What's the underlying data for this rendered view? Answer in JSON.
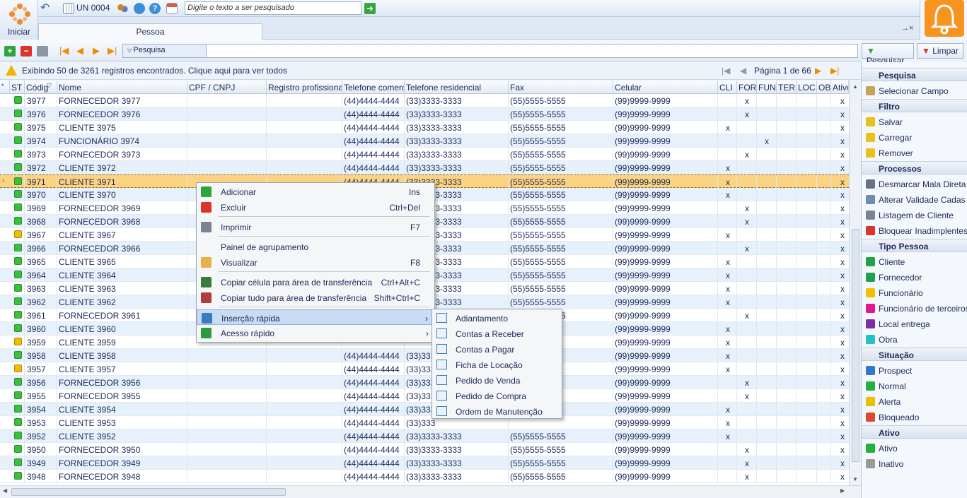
{
  "toolbar": {
    "start_label": "Iniciar",
    "unit_label": "UN 0004",
    "search_placeholder": "Digite o texto a ser pesquisado"
  },
  "tab": {
    "label": "Pessoa",
    "controls": "→×"
  },
  "toolbar2": {
    "search_label": "Pesquisa",
    "search_button": "Pesquisar",
    "clear_button": "Limpar"
  },
  "status": {
    "message": "Exibindo 50 de 3261 registros encontrados. Clique aqui para ver todos",
    "page": "Página 1 de 66"
  },
  "columns": [
    {
      "key": "st",
      "label": "ST"
    },
    {
      "key": "cod",
      "label": "Códig"
    },
    {
      "key": "nome",
      "label": "Nome"
    },
    {
      "key": "cpf",
      "label": "CPF / CNPJ"
    },
    {
      "key": "reg",
      "label": "Registro profissional"
    },
    {
      "key": "tc",
      "label": "Telefone comercial"
    },
    {
      "key": "tr",
      "label": "Telefone residencial"
    },
    {
      "key": "fax",
      "label": "Fax"
    },
    {
      "key": "cel",
      "label": "Celular"
    },
    {
      "key": "cli",
      "label": "CLI"
    },
    {
      "key": "for",
      "label": "FOR"
    },
    {
      "key": "fun",
      "label": "FUN"
    },
    {
      "key": "ter",
      "label": "TER"
    },
    {
      "key": "loc",
      "label": "LOC"
    },
    {
      "key": "obr",
      "label": "OBI"
    },
    {
      "key": "ativo",
      "label": "Ativo"
    }
  ],
  "rows": [
    {
      "st": "green",
      "cod": "3977",
      "nome": "FORNECEDOR  3977",
      "tc": "(44)4444-4444",
      "tr": "(33)3333-3333",
      "fax": "(55)5555-5555",
      "cel": "(99)9999-9999",
      "flag": "for"
    },
    {
      "st": "green",
      "cod": "3976",
      "nome": "FORNECEDOR  3976",
      "tc": "(44)4444-4444",
      "tr": "(33)3333-3333",
      "fax": "(55)5555-5555",
      "cel": "(99)9999-9999",
      "flag": "for"
    },
    {
      "st": "green",
      "cod": "3975",
      "nome": "CLIENTE  3975",
      "tc": "(44)4444-4444",
      "tr": "(33)3333-3333",
      "fax": "(55)5555-5555",
      "cel": "(99)9999-9999",
      "flag": "cli"
    },
    {
      "st": "green",
      "cod": "3974",
      "nome": "FUNCIONÁRIO  3974",
      "tc": "(44)4444-4444",
      "tr": "(33)3333-3333",
      "fax": "(55)5555-5555",
      "cel": "(99)9999-9999",
      "flag": "fun"
    },
    {
      "st": "green",
      "cod": "3973",
      "nome": "FORNECEDOR  3973",
      "tc": "(44)4444-4444",
      "tr": "(33)3333-3333",
      "fax": "(55)5555-5555",
      "cel": "(99)9999-9999",
      "flag": "for"
    },
    {
      "st": "green",
      "cod": "3972",
      "nome": "CLIENTE  3972",
      "tc": "(44)4444-4444",
      "tr": "(33)3333-3333",
      "fax": "(55)5555-5555",
      "cel": "(99)9999-9999",
      "flag": "cli"
    },
    {
      "st": "green",
      "cod": "3971",
      "nome": "CLIENTE  3971",
      "tc": "(44)4444-4444",
      "tr": "(33)3333-3333",
      "fax": "(55)5555-5555",
      "cel": "(99)9999-9999",
      "flag": "cli",
      "selected": true
    },
    {
      "st": "green",
      "cod": "3970",
      "nome": "CLIENTE  3970",
      "tc": "",
      "tr": "(33)3333-3333",
      "fax": "(55)5555-5555",
      "cel": "(99)9999-9999",
      "flag": "cli"
    },
    {
      "st": "green",
      "cod": "3969",
      "nome": "FORNECEDOR  3969",
      "tc": "",
      "tr": "(33)3333-3333",
      "fax": "(55)5555-5555",
      "cel": "(99)9999-9999",
      "flag": "for"
    },
    {
      "st": "green",
      "cod": "3968",
      "nome": "FORNECEDOR  3968",
      "tc": "",
      "tr": "(33)3333-3333",
      "fax": "(55)5555-5555",
      "cel": "(99)9999-9999",
      "flag": "for"
    },
    {
      "st": "yellow",
      "cod": "3967",
      "nome": "CLIENTE  3967",
      "tc": "",
      "tr": "(33)3333-3333",
      "fax": "(55)5555-5555",
      "cel": "(99)9999-9999",
      "flag": "cli"
    },
    {
      "st": "green",
      "cod": "3966",
      "nome": "FORNECEDOR  3966",
      "tc": "",
      "tr": "(33)3333-3333",
      "fax": "(55)5555-5555",
      "cel": "(99)9999-9999",
      "flag": "for"
    },
    {
      "st": "green",
      "cod": "3965",
      "nome": "CLIENTE  3965",
      "tc": "",
      "tr": "(33)3333-3333",
      "fax": "(55)5555-5555",
      "cel": "(99)9999-9999",
      "flag": "cli"
    },
    {
      "st": "green",
      "cod": "3964",
      "nome": "CLIENTE  3964",
      "tc": "",
      "tr": "(33)3333-3333",
      "fax": "(55)5555-5555",
      "cel": "(99)9999-9999",
      "flag": "cli"
    },
    {
      "st": "green",
      "cod": "3963",
      "nome": "CLIENTE  3963",
      "tc": "",
      "tr": "(33)3333-3333",
      "fax": "(55)5555-5555",
      "cel": "(99)9999-9999",
      "flag": "cli"
    },
    {
      "st": "green",
      "cod": "3962",
      "nome": "CLIENTE  3962",
      "tc": "",
      "tr": "(33)3333-3333",
      "fax": "(55)5555-5555",
      "cel": "(99)9999-9999",
      "flag": "cli"
    },
    {
      "st": "green",
      "cod": "3961",
      "nome": "FORNECEDOR  3961",
      "tc": "",
      "tr": "",
      "fax": "(55)5555-5555",
      "cel": "(99)9999-9999",
      "flag": "for"
    },
    {
      "st": "green",
      "cod": "3960",
      "nome": "CLIENTE  3960",
      "tc": "",
      "tr": "",
      "fax": "",
      "cel": "(99)9999-9999",
      "flag": "cli"
    },
    {
      "st": "yellow",
      "cod": "3959",
      "nome": "CLIENTE  3959",
      "tc": "",
      "tr": "",
      "fax": "",
      "cel": "(99)9999-9999",
      "flag": "cli"
    },
    {
      "st": "green",
      "cod": "3958",
      "nome": "CLIENTE  3958",
      "tc": "(44)4444-4444",
      "tr": "(33)333",
      "fax": "",
      "cel": "(99)9999-9999",
      "flag": "cli"
    },
    {
      "st": "yellow",
      "cod": "3957",
      "nome": "CLIENTE  3957",
      "tc": "(44)4444-4444",
      "tr": "(33)333",
      "fax": "",
      "cel": "(99)9999-9999",
      "flag": "cli"
    },
    {
      "st": "green",
      "cod": "3956",
      "nome": "FORNECEDOR  3956",
      "tc": "(44)4444-4444",
      "tr": "(33)333",
      "fax": "",
      "cel": "(99)9999-9999",
      "flag": "for"
    },
    {
      "st": "green",
      "cod": "3955",
      "nome": "FORNECEDOR  3955",
      "tc": "(44)4444-4444",
      "tr": "(33)333",
      "fax": "",
      "cel": "(99)9999-9999",
      "flag": "for"
    },
    {
      "st": "green",
      "cod": "3954",
      "nome": "CLIENTE  3954",
      "tc": "(44)4444-4444",
      "tr": "(33)333",
      "fax": "",
      "cel": "(99)9999-9999",
      "flag": "cli"
    },
    {
      "st": "green",
      "cod": "3953",
      "nome": "CLIENTE  3953",
      "tc": "(44)4444-4444",
      "tr": "(33)333",
      "fax": "",
      "cel": "(99)9999-9999",
      "flag": "cli"
    },
    {
      "st": "green",
      "cod": "3952",
      "nome": "CLIENTE  3952",
      "tc": "(44)4444-4444",
      "tr": "(33)3333-3333",
      "fax": "(55)5555-5555",
      "cel": "(99)9999-9999",
      "flag": "cli"
    },
    {
      "st": "green",
      "cod": "3950",
      "nome": "FORNECEDOR  3950",
      "tc": "(44)4444-4444",
      "tr": "(33)3333-3333",
      "fax": "(55)5555-5555",
      "cel": "(99)9999-9999",
      "flag": "for"
    },
    {
      "st": "green",
      "cod": "3949",
      "nome": "FORNECEDOR  3949",
      "tc": "(44)4444-4444",
      "tr": "(33)3333-3333",
      "fax": "(55)5555-5555",
      "cel": "(99)9999-9999",
      "flag": "for"
    },
    {
      "st": "green",
      "cod": "3948",
      "nome": "FORNECEDOR  3948",
      "tc": "(44)4444-4444",
      "tr": "(33)3333-3333",
      "fax": "(55)5555-5555",
      "cel": "(99)9999-9999",
      "flag": "for"
    }
  ],
  "mark": "x",
  "context_menu": [
    {
      "label": "Adicionar",
      "shortcut": "Ins",
      "icon": "plus-icon",
      "color": "#2fa43a"
    },
    {
      "label": "Excluir",
      "shortcut": "Ctrl+Del",
      "icon": "minus-icon",
      "color": "#d9352b"
    },
    {
      "sep": true
    },
    {
      "label": "Imprimir",
      "shortcut": "F7",
      "icon": "printer-icon",
      "color": "#7a8594"
    },
    {
      "sep": true
    },
    {
      "label": "Painel de agrupamento",
      "shortcut": "",
      "icon": "",
      "color": ""
    },
    {
      "label": "Visualizar",
      "shortcut": "F8",
      "icon": "hand-icon",
      "color": "#e8b04a"
    },
    {
      "sep": true
    },
    {
      "label": "Copiar célula para área de transferência",
      "shortcut": "Ctrl+Alt+C",
      "icon": "copy-cell-icon",
      "color": "#3c7a3c"
    },
    {
      "label": "Copiar tudo para área de transferência",
      "shortcut": "Shift+Ctrl+C",
      "icon": "copy-all-icon",
      "color": "#b23b3b"
    },
    {
      "sep": true
    },
    {
      "label": "Inserção rápida",
      "shortcut": "›",
      "icon": "quick-insert-icon",
      "color": "#3a7cc0",
      "highlight": true
    },
    {
      "label": "Acesso rápido",
      "shortcut": "›",
      "icon": "arrow-icon",
      "color": "#2f9a3a"
    }
  ],
  "submenu": [
    "Adiantamento",
    "Contas a Receber",
    "Contas a Pagar",
    "Ficha de Locação",
    "Pedido de Venda",
    "Pedido de Compra",
    "Ordem de Manutenção"
  ],
  "panel": [
    {
      "header": "Pesquisa"
    },
    {
      "label": "Selecionar Campo",
      "color": "#c9a25a"
    },
    {
      "header": "Filtro"
    },
    {
      "label": "Salvar",
      "color": "#e6c21a"
    },
    {
      "label": "Carregar",
      "color": "#e6c21a"
    },
    {
      "label": "Remover",
      "color": "#e6c21a"
    },
    {
      "header": "Processos"
    },
    {
      "label": "Desmarcar Mala Direta",
      "color": "#6a7480"
    },
    {
      "label": "Alterar Validade Cadas",
      "color": "#6a8fb0"
    },
    {
      "label": "Listagem de Cliente",
      "color": "#7a8594"
    },
    {
      "label": "Bloquear Inadimplentes",
      "color": "#d9352b"
    },
    {
      "header": "Tipo Pessoa"
    },
    {
      "label": "Cliente",
      "color": "#1ea34a"
    },
    {
      "label": "Fornecedor",
      "color": "#1ea34a"
    },
    {
      "label": "Funcionário",
      "color": "#f2c000"
    },
    {
      "label": "Funcionário de terceiros",
      "color": "#e0198c"
    },
    {
      "label": "Local entrega",
      "color": "#7a2fa8"
    },
    {
      "label": "Obra",
      "color": "#22c2c8"
    },
    {
      "header": "Situação"
    },
    {
      "label": "Prospect",
      "color": "#2f79d0"
    },
    {
      "label": "Normal",
      "color": "#22b040"
    },
    {
      "label": "Alerta",
      "color": "#e8c000"
    },
    {
      "label": "Bloqueado",
      "color": "#e0482b"
    },
    {
      "header": "Ativo"
    },
    {
      "label": "Ativo",
      "color": "#22b040"
    },
    {
      "label": "Inativo",
      "color": "#9a9a9a"
    }
  ],
  "colors": {
    "green": "#3cbf3c",
    "yellow": "#f2bc00"
  }
}
